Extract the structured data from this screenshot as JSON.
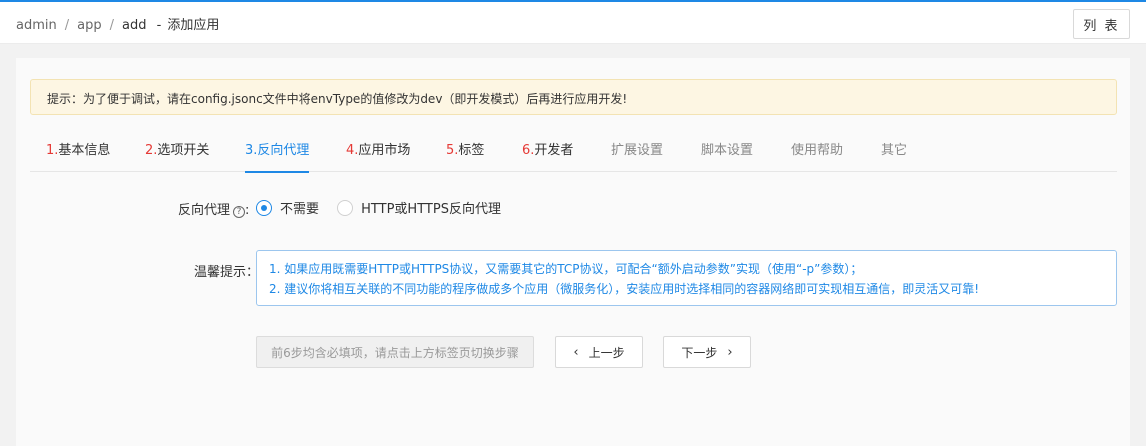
{
  "breadcrumb": {
    "items": [
      "admin",
      "app",
      "add"
    ],
    "separator": "/",
    "dash": "-",
    "page_title": "添加应用"
  },
  "header": {
    "list_button": "列 表"
  },
  "alert": {
    "prefix": "提示：为了便于调试，请在config.jsonc文件中将envType的值修改为dev（即开发模式）后再进行应用开发!"
  },
  "tabs": [
    {
      "num": "1.",
      "label": "基本信息",
      "state": "normal"
    },
    {
      "num": "2.",
      "label": "选项开关",
      "state": "normal"
    },
    {
      "num": "3.",
      "label": "反向代理",
      "state": "active"
    },
    {
      "num": "4.",
      "label": "应用市场",
      "state": "normal"
    },
    {
      "num": "5.",
      "label": "标签",
      "state": "normal"
    },
    {
      "num": "6.",
      "label": "开发者",
      "state": "normal"
    },
    {
      "num": "",
      "label": "扩展设置",
      "state": "inactive"
    },
    {
      "num": "",
      "label": "脚本设置",
      "state": "inactive"
    },
    {
      "num": "",
      "label": "使用帮助",
      "state": "inactive"
    },
    {
      "num": "",
      "label": "其它",
      "state": "inactive"
    }
  ],
  "proxy": {
    "label": "反向代理",
    "help_glyph": "?",
    "colon": ":",
    "options": [
      {
        "label": "不需要",
        "checked": true
      },
      {
        "label": "HTTP或HTTPS反向代理",
        "checked": false
      }
    ]
  },
  "tips": {
    "label": "温馨提示：",
    "lines": [
      "1. 如果应用既需要HTTP或HTTPS协议，又需要其它的TCP协议，可配合“额外启动参数”实现（使用“-p”参数）；",
      "2. 建议你将相互关联的不同功能的程序做成多个应用（微服务化），安装应用时选择相同的容器网络即可实现相互通信，即灵活又可靠!"
    ]
  },
  "buttons": {
    "required_hint": "前6步均含必填项，请点击上方标签页切换步骤",
    "prev": "上一步",
    "next": "下一步",
    "prev_glyph": "‹",
    "next_glyph": "›"
  },
  "colors": {
    "accent": "#1e88e5",
    "step_number": "#e53935",
    "alert_bg": "#fdf6e3"
  }
}
